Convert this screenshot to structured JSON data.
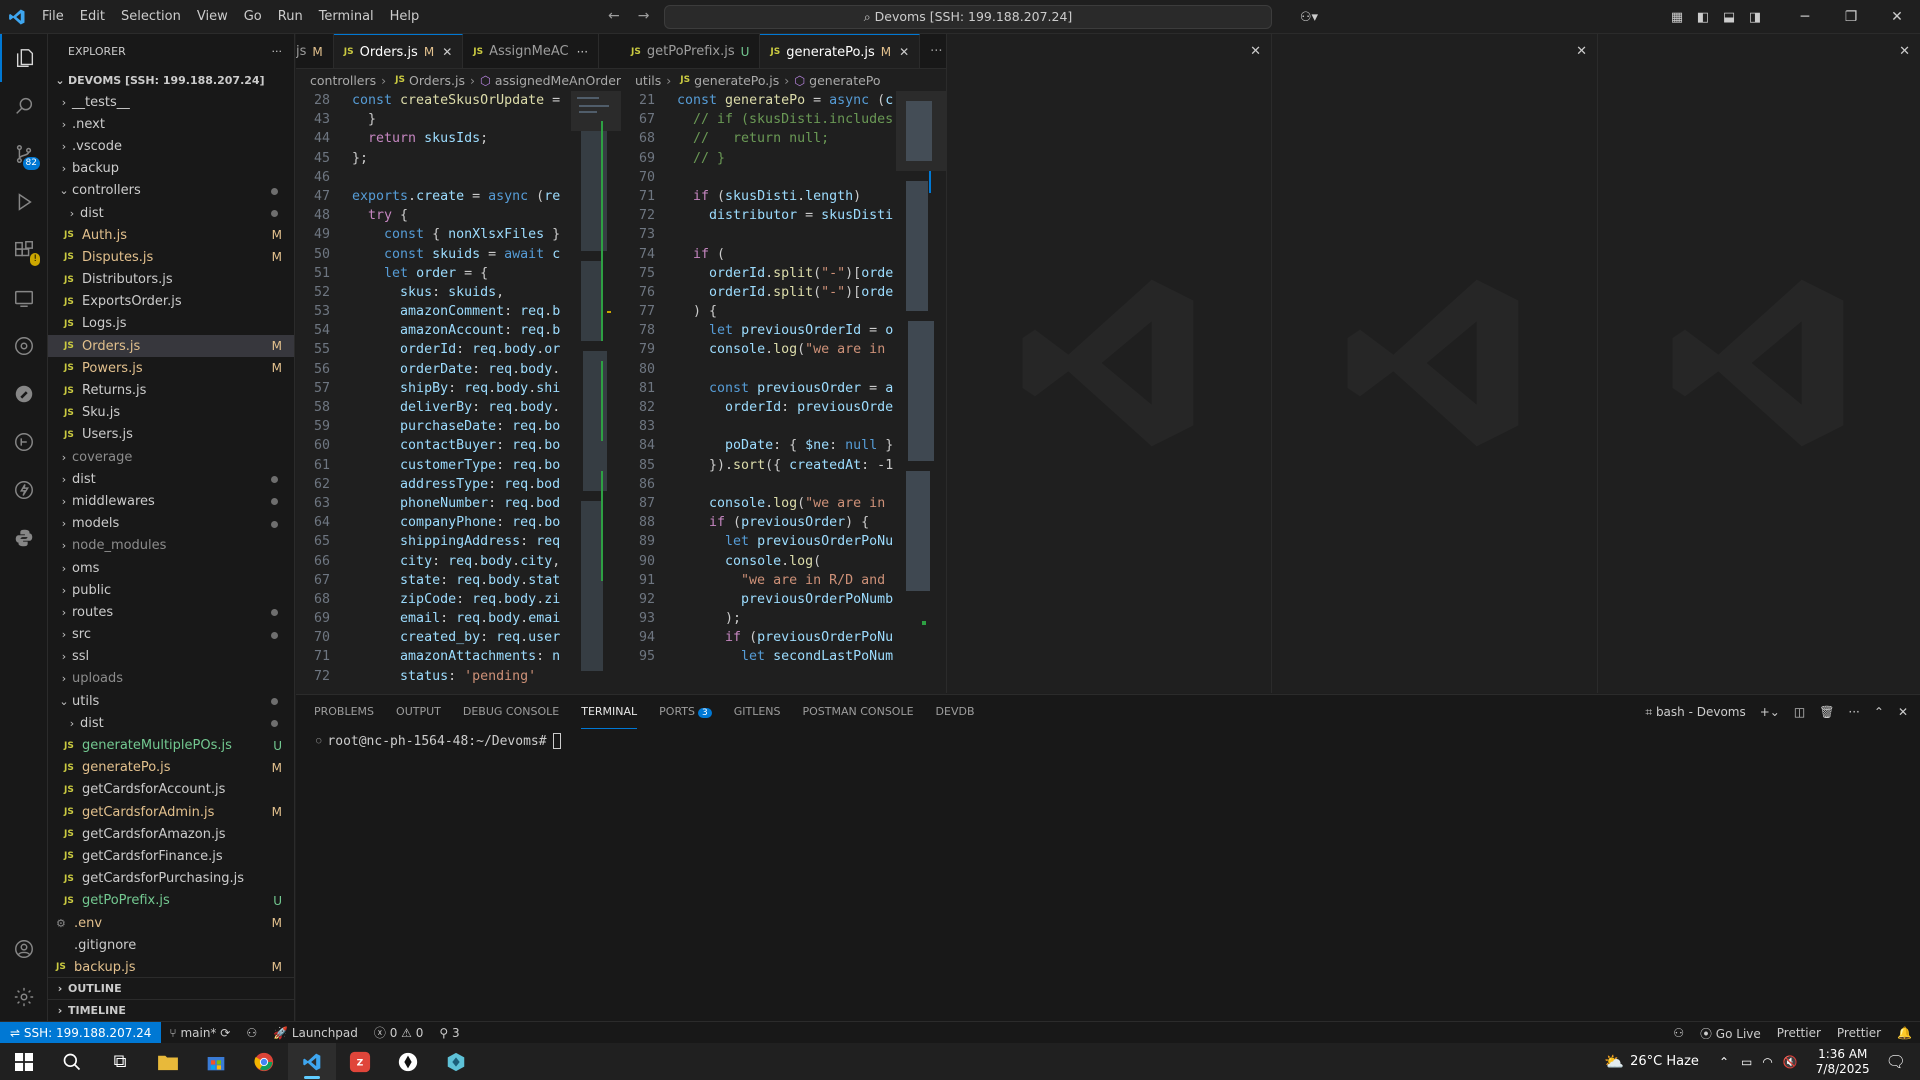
{
  "titlebar": {
    "menu": [
      "File",
      "Edit",
      "Selection",
      "View",
      "Go",
      "Run",
      "Terminal",
      "Help"
    ],
    "command_center": "Devoms [SSH: 199.188.207.24]"
  },
  "activity": {
    "scm_badge": "82"
  },
  "sidebar": {
    "title": "EXPLORER",
    "root": "DEVOMS [SSH: 199.188.207.24]",
    "items": [
      {
        "label": "__tests__",
        "type": "folder",
        "depth": 0,
        "status": ""
      },
      {
        "label": ".next",
        "type": "folder",
        "depth": 0,
        "status": ""
      },
      {
        "label": ".vscode",
        "type": "folder",
        "depth": 0,
        "status": ""
      },
      {
        "label": "backup",
        "type": "folder",
        "depth": 0,
        "status": ""
      },
      {
        "label": "controllers",
        "type": "folder-open",
        "depth": 0,
        "status": "dot"
      },
      {
        "label": "dist",
        "type": "folder",
        "depth": 1,
        "status": "dot"
      },
      {
        "label": "Auth.js",
        "type": "js",
        "depth": 1,
        "status": "M"
      },
      {
        "label": "Disputes.js",
        "type": "js",
        "depth": 1,
        "status": "M"
      },
      {
        "label": "Distributors.js",
        "type": "js",
        "depth": 1,
        "status": ""
      },
      {
        "label": "ExportsOrder.js",
        "type": "js",
        "depth": 1,
        "status": ""
      },
      {
        "label": "Logs.js",
        "type": "js",
        "depth": 1,
        "status": ""
      },
      {
        "label": "Orders.js",
        "type": "js",
        "depth": 1,
        "status": "M",
        "selected": true
      },
      {
        "label": "Powers.js",
        "type": "js",
        "depth": 1,
        "status": "M"
      },
      {
        "label": "Returns.js",
        "type": "js",
        "depth": 1,
        "status": ""
      },
      {
        "label": "Sku.js",
        "type": "js",
        "depth": 1,
        "status": ""
      },
      {
        "label": "Users.js",
        "type": "js",
        "depth": 1,
        "status": ""
      },
      {
        "label": "coverage",
        "type": "folder",
        "depth": 0,
        "status": "",
        "dim": true
      },
      {
        "label": "dist",
        "type": "folder",
        "depth": 0,
        "status": "dot"
      },
      {
        "label": "middlewares",
        "type": "folder",
        "depth": 0,
        "status": "dot"
      },
      {
        "label": "models",
        "type": "folder",
        "depth": 0,
        "status": "dot"
      },
      {
        "label": "node_modules",
        "type": "folder",
        "depth": 0,
        "status": "",
        "dim": true
      },
      {
        "label": "oms",
        "type": "folder",
        "depth": 0,
        "status": ""
      },
      {
        "label": "public",
        "type": "folder",
        "depth": 0,
        "status": ""
      },
      {
        "label": "routes",
        "type": "folder",
        "depth": 0,
        "status": "dot"
      },
      {
        "label": "src",
        "type": "folder",
        "depth": 0,
        "status": "dot"
      },
      {
        "label": "ssl",
        "type": "folder",
        "depth": 0,
        "status": ""
      },
      {
        "label": "uploads",
        "type": "folder",
        "depth": 0,
        "status": "",
        "dim": true
      },
      {
        "label": "utils",
        "type": "folder-open",
        "depth": 0,
        "status": "dot"
      },
      {
        "label": "dist",
        "type": "folder",
        "depth": 1,
        "status": "dot"
      },
      {
        "label": "generateMultiplePOs.js",
        "type": "js",
        "depth": 1,
        "status": "U"
      },
      {
        "label": "generatePo.js",
        "type": "js",
        "depth": 1,
        "status": "M"
      },
      {
        "label": "getCardsforAccount.js",
        "type": "js",
        "depth": 1,
        "status": ""
      },
      {
        "label": "getCardsforAdmin.js",
        "type": "js",
        "depth": 1,
        "status": "M"
      },
      {
        "label": "getCardsforAmazon.js",
        "type": "js",
        "depth": 1,
        "status": ""
      },
      {
        "label": "getCardsforFinance.js",
        "type": "js",
        "depth": 1,
        "status": ""
      },
      {
        "label": "getCardsforPurchasing.js",
        "type": "js",
        "depth": 1,
        "status": ""
      },
      {
        "label": "getPoPrefix.js",
        "type": "js",
        "depth": 1,
        "status": "U"
      },
      {
        "label": ".env",
        "type": "gear",
        "depth": 0,
        "status": "M"
      },
      {
        "label": ".gitignore",
        "type": "none",
        "depth": 0,
        "status": ""
      },
      {
        "label": "backup.js",
        "type": "js",
        "depth": 0,
        "status": "M"
      }
    ],
    "outline": "OUTLINE",
    "timeline": "TIMELINE"
  },
  "editor1": {
    "tabs": [
      {
        "label": "js",
        "mark": "M",
        "active": false,
        "partial": true
      },
      {
        "label": "Orders.js",
        "mark": "M",
        "active": true,
        "close": true
      },
      {
        "label": "AssignMeAC",
        "mark": "",
        "active": false,
        "more": true
      }
    ],
    "breadcrumb": [
      "controllers",
      "Orders.js",
      "assignedMeAnOrder"
    ],
    "lines": [
      {
        "n": "28",
        "t": "const createSkusOrUpdate = "
      },
      {
        "n": "43",
        "t": "  }"
      },
      {
        "n": "44",
        "t": "  return skusIds;"
      },
      {
        "n": "45",
        "t": "};"
      },
      {
        "n": "46",
        "t": ""
      },
      {
        "n": "47",
        "t": "exports.create = async (re"
      },
      {
        "n": "48",
        "t": "  try {"
      },
      {
        "n": "49",
        "t": "    const { nonXlsxFiles }"
      },
      {
        "n": "50",
        "t": "    const skuids = await c"
      },
      {
        "n": "51",
        "t": "    let order = {"
      },
      {
        "n": "52",
        "t": "      skus: skuids,"
      },
      {
        "n": "53",
        "t": "      amazonComment: req.b"
      },
      {
        "n": "54",
        "t": "      amazonAccount: req.b"
      },
      {
        "n": "55",
        "t": "      orderId: req.body.or"
      },
      {
        "n": "56",
        "t": "      orderDate: req.body."
      },
      {
        "n": "57",
        "t": "      shipBy: req.body.shi"
      },
      {
        "n": "58",
        "t": "      deliverBy: req.body."
      },
      {
        "n": "59",
        "t": "      purchaseDate: req.bo"
      },
      {
        "n": "60",
        "t": "      contactBuyer: req.bo"
      },
      {
        "n": "61",
        "t": "      customerType: req.bo"
      },
      {
        "n": "62",
        "t": "      addressType: req.bod"
      },
      {
        "n": "63",
        "t": "      phoneNumber: req.bod"
      },
      {
        "n": "64",
        "t": "      companyPhone: req.bo"
      },
      {
        "n": "65",
        "t": "      shippingAddress: req"
      },
      {
        "n": "66",
        "t": "      city: req.body.city,"
      },
      {
        "n": "67",
        "t": "      state: req.body.stat"
      },
      {
        "n": "68",
        "t": "      zipCode: req.body.zi"
      },
      {
        "n": "69",
        "t": "      email: req.body.emai"
      },
      {
        "n": "70",
        "t": "      created_by: req.user"
      },
      {
        "n": "71",
        "t": "      amazonAttachments: n"
      },
      {
        "n": "72",
        "t": "      status: 'pending'"
      }
    ]
  },
  "editor2": {
    "tabs": [
      {
        "label": "getPoPrefix.js",
        "mark": "U",
        "active": false
      },
      {
        "label": "generatePo.js",
        "mark": "M",
        "active": true,
        "close": true
      }
    ],
    "breadcrumb": [
      "utils",
      "generatePo.js",
      "generatePo"
    ],
    "lines": [
      {
        "n": "21",
        "t": "const generatePo = async (c"
      },
      {
        "n": "67",
        "t": "  // if (skusDisti.includes"
      },
      {
        "n": "68",
        "t": "  //   return null;"
      },
      {
        "n": "69",
        "t": "  // }"
      },
      {
        "n": "70",
        "t": ""
      },
      {
        "n": "71",
        "t": "  if (skusDisti.length)"
      },
      {
        "n": "72",
        "t": "    distributor = skusDisti"
      },
      {
        "n": "73",
        "t": ""
      },
      {
        "n": "74",
        "t": "  if ("
      },
      {
        "n": "75",
        "t": "    orderId.split(\"-\")[orde"
      },
      {
        "n": "76",
        "t": "    orderId.split(\"-\")[orde"
      },
      {
        "n": "77",
        "t": "  ) {"
      },
      {
        "n": "78",
        "t": "    let previousOrderId = o"
      },
      {
        "n": "79",
        "t": "    console.log(\"we are in"
      },
      {
        "n": "80",
        "t": ""
      },
      {
        "n": "81",
        "t": "    const previousOrder = a"
      },
      {
        "n": "82",
        "t": "      orderId: previousOrde"
      },
      {
        "n": "83",
        "t": ""
      },
      {
        "n": "84",
        "t": "      poDate: { $ne: null }"
      },
      {
        "n": "85",
        "t": "    }).sort({ createdAt: -1"
      },
      {
        "n": "86",
        "t": ""
      },
      {
        "n": "87",
        "t": "    console.log(\"we are in"
      },
      {
        "n": "88",
        "t": "    if (previousOrder) {"
      },
      {
        "n": "89",
        "t": "      let previousOrderPoNu"
      },
      {
        "n": "90",
        "t": "      console.log("
      },
      {
        "n": "91",
        "t": "        \"we are in R/D and"
      },
      {
        "n": "92",
        "t": "        previousOrderPoNumb"
      },
      {
        "n": "93",
        "t": "      );"
      },
      {
        "n": "94",
        "t": "      if (previousOrderPoNu"
      },
      {
        "n": "95",
        "t": "        let secondLastPoNum"
      }
    ]
  },
  "panel": {
    "tabs": [
      "PROBLEMS",
      "OUTPUT",
      "DEBUG CONSOLE",
      "TERMINAL",
      "PORTS",
      "GITLENS",
      "POSTMAN CONSOLE",
      "DEVDB"
    ],
    "active_tab": "TERMINAL",
    "ports_badge": "3",
    "terminal_name": "bash - Devoms",
    "prompt": "root@nc-ph-1564-48:~/Devoms#"
  },
  "statusbar": {
    "remote": "SSH: 199.188.207.24",
    "branch": "main*",
    "launchpad": "Launchpad",
    "errors": "0",
    "warnings": "0",
    "ports": "3",
    "go_live": "Go Live",
    "prettier1": "Prettier",
    "prettier2": "Prettier"
  },
  "taskbar": {
    "weather": "26°C  Haze",
    "time": "1:36 AM",
    "date": "7/8/2025"
  }
}
